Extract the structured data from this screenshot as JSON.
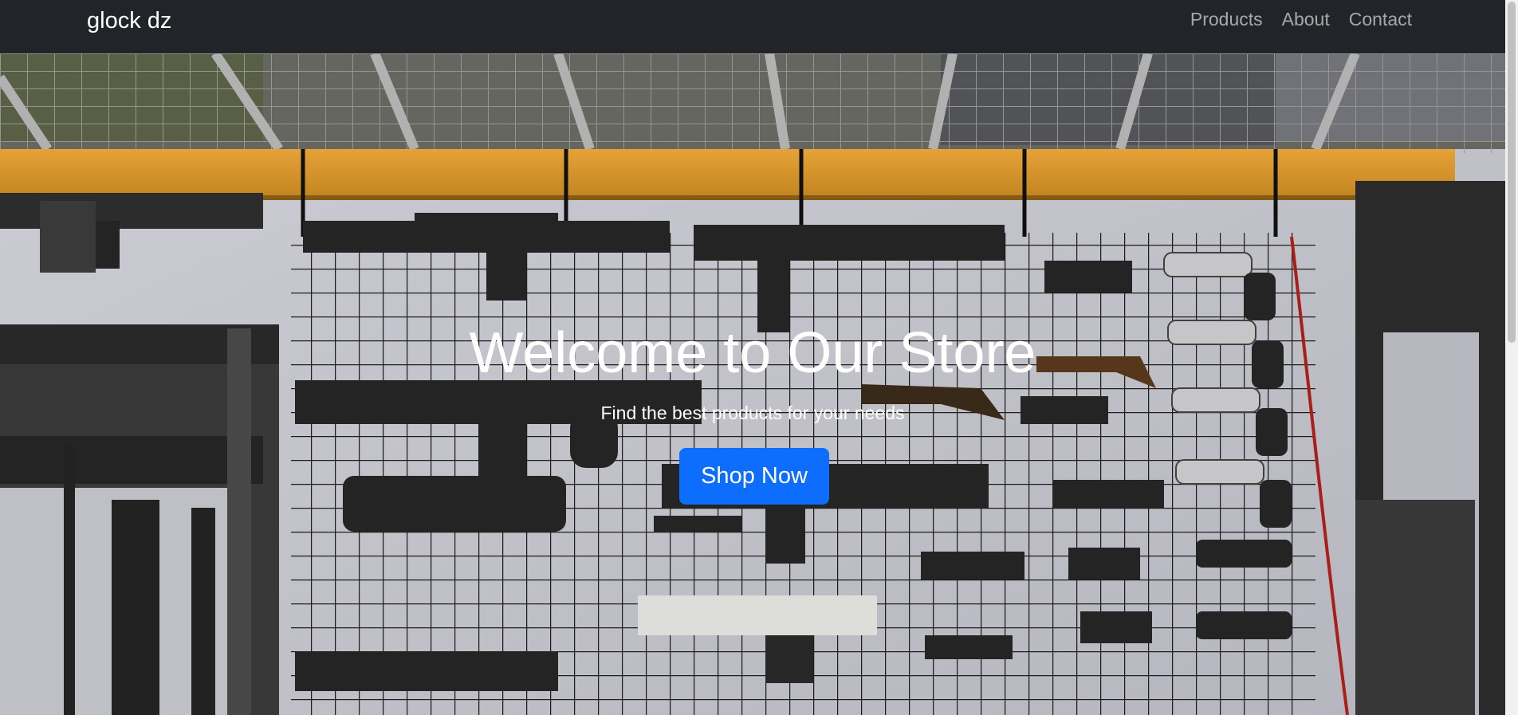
{
  "navbar": {
    "brand": "glock dz",
    "links": [
      {
        "label": "Products"
      },
      {
        "label": "About"
      },
      {
        "label": "Contact"
      }
    ],
    "background": "#212529"
  },
  "hero": {
    "title": "Welcome to Our Store",
    "subtitle": "Find the best products for your needs",
    "cta_label": "Shop Now",
    "cta_color": "#0d6efd",
    "background_image": "gun-store-wall-display"
  }
}
